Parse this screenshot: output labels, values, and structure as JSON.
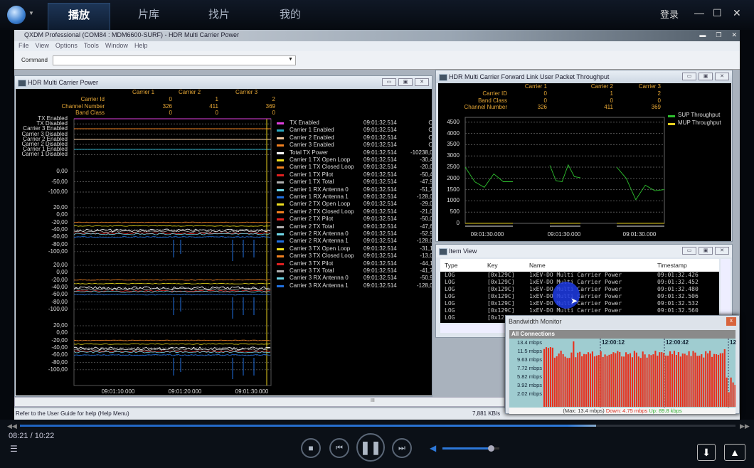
{
  "player": {
    "tabs": [
      "播放",
      "片库",
      "找片",
      "我的"
    ],
    "login": "登录",
    "time": "08:21 / 10:22",
    "progress": 0.805,
    "volume": 0.85,
    "icons": [
      "logo-icon",
      "minimize-icon",
      "maximize-icon",
      "close-icon",
      "stop-icon",
      "previous-icon",
      "pause-icon",
      "next-icon",
      "volume-icon",
      "playlist-icon",
      "download-icon",
      "share-icon"
    ]
  },
  "app": {
    "title": "QXDM Professional (COM84 : MDM6600-SURF) - HDR Multi Carrier Power",
    "menu": [
      "File",
      "View",
      "Options",
      "Tools",
      "Window",
      "Help"
    ],
    "command_label": "Command",
    "command_value": "",
    "status": "Refer to the User Guide for help (Help Menu)",
    "rate": "7,881 KB/s"
  },
  "power": {
    "title": "HDR Multi Carrier Power",
    "carriers": [
      "Carrier 1",
      "Carrier 2",
      "Carrier 3"
    ],
    "rows": [
      {
        "label": "Carrier Id",
        "vals": [
          "0",
          "1",
          "2"
        ]
      },
      {
        "label": "Channel Number",
        "vals": [
          "326",
          "411",
          "369"
        ]
      },
      {
        "label": "Band Class",
        "vals": [
          "0",
          "0",
          "0"
        ]
      }
    ],
    "state_labels": [
      "TX Enabled",
      "TX Disabled",
      "Carrier 3 Enabled",
      "Carrier 3 Disabled",
      "Carrier 2 Enabled",
      "Carrier 2 Disabled",
      "Carrier 1 Enabled",
      "Carrier 1 Disabled"
    ],
    "panel1_ticks": [
      "0,00",
      "-50,00",
      "-100,00"
    ],
    "panel_ticks": [
      "20,00",
      "0,00",
      "-20,00",
      "-40,00",
      "-60,00",
      "-80,00",
      "-100,00"
    ],
    "x_ticks": [
      "09:01:10.000",
      "09:01:20.000",
      "09:01:30.000"
    ],
    "legend": [
      {
        "name": "TX Enabled",
        "time": "09:01:32.514",
        "value": "On",
        "color": "#e040e0"
      },
      {
        "name": "Carrier 1 Enabled",
        "time": "09:01:32.514",
        "value": "On",
        "color": "#2aa8c0"
      },
      {
        "name": "Carrier 2 Enabled",
        "time": "09:01:32.514",
        "value": "On",
        "color": "#f0c8a0"
      },
      {
        "name": "Carrier 3 Enabled",
        "time": "09:01:32.514",
        "value": "On",
        "color": "#f08020"
      },
      {
        "name": "Total TX Power",
        "time": "09:01:32.514",
        "value": "-10238,00",
        "color": "#ffffff"
      },
      {
        "name": "Carrier 1 TX Open Loop",
        "time": "09:01:32.514",
        "value": "-30,41",
        "color": "#f0e020"
      },
      {
        "name": "Carrier 1 TX Closed Loop",
        "time": "09:01:32.514",
        "value": "-20,00",
        "color": "#f08020"
      },
      {
        "name": "Carrier 1 TX Pilot",
        "time": "09:01:32.514",
        "value": "-50,41",
        "color": "#e02020"
      },
      {
        "name": "Carrier 1 TX Total",
        "time": "09:01:32.514",
        "value": "-47,97",
        "color": "#b0b0b0"
      },
      {
        "name": "Carrier 1 RX Antenna 0",
        "time": "09:01:32.514",
        "value": "-51,78",
        "color": "#70d8e8"
      },
      {
        "name": "Carrier 1 RX Antenna 1",
        "time": "09:01:32.514",
        "value": "-128,00",
        "color": "#2070e0"
      },
      {
        "name": "Carrier 2 TX Open Loop",
        "time": "09:01:32.514",
        "value": "-29,06",
        "color": "#f0e020"
      },
      {
        "name": "Carrier 2 TX Closed Loop",
        "time": "09:01:32.514",
        "value": "-21,00",
        "color": "#f08020"
      },
      {
        "name": "Carrier 2 TX Pilot",
        "time": "09:01:32.514",
        "value": "-50,06",
        "color": "#e02020"
      },
      {
        "name": "Carrier 2 TX Total",
        "time": "09:01:32.514",
        "value": "-47,62",
        "color": "#b0b0b0"
      },
      {
        "name": "Carrier 2 RX Antenna 0",
        "time": "09:01:32.514",
        "value": "-52,94",
        "color": "#70d8e8"
      },
      {
        "name": "Carrier 2 RX Antenna 1",
        "time": "09:01:32.514",
        "value": "-128,00",
        "color": "#2070e0"
      },
      {
        "name": "Carrier 3 TX Open Loop",
        "time": "09:01:32.514",
        "value": "-31,18",
        "color": "#f0e020"
      },
      {
        "name": "Carrier 3 TX Closed Loop",
        "time": "09:01:32.514",
        "value": "-13,00",
        "color": "#f08020"
      },
      {
        "name": "Carrier 3 TX Pilot",
        "time": "09:01:32.514",
        "value": "-44,18",
        "color": "#e02020"
      },
      {
        "name": "Carrier 3 TX Total",
        "time": "09:01:32.514",
        "value": "-41,73",
        "color": "#b0b0b0"
      },
      {
        "name": "Carrier 3 RX Antenna 0",
        "time": "09:01:32.514",
        "value": "-50,91",
        "color": "#70d8e8"
      },
      {
        "name": "Carrier 3 RX Antenna 1",
        "time": "09:01:32.514",
        "value": "-128,00",
        "color": "#2070e0"
      }
    ]
  },
  "throughput": {
    "title": "HDR Multi Carrier Forward Link User Packet Throughput",
    "carriers": [
      "Carrier 1",
      "Carrier 2",
      "Carrier 3"
    ],
    "rows": [
      {
        "label": "Carrier ID",
        "vals": [
          "0",
          "1",
          "2"
        ]
      },
      {
        "label": "Band Class",
        "vals": [
          "0",
          "0",
          "0"
        ]
      },
      {
        "label": "Channel Number",
        "vals": [
          "326",
          "411",
          "369"
        ]
      }
    ],
    "legend": [
      {
        "name": "SUP Throughput",
        "color": "#2ec02e"
      },
      {
        "name": "MUP Throughput",
        "color": "#e8d020"
      }
    ],
    "y_ticks": [
      "4500",
      "4000",
      "3500",
      "3000",
      "2500",
      "2000",
      "1500",
      "1000",
      "500",
      "0"
    ],
    "x_ticks": [
      "09:01:30.000",
      "09:01:30.000",
      "09:01:30.000"
    ],
    "sup_segments": [
      [
        2500,
        1850,
        1600,
        2200,
        1850,
        1850
      ],
      [
        2580,
        1900,
        1850,
        2600,
        2080,
        2030
      ],
      [
        2500,
        2000,
        1050,
        1700,
        1450,
        1500
      ]
    ]
  },
  "items": {
    "title": "Item View",
    "columns": [
      "Type",
      "Key",
      "Name",
      "Timestamp"
    ],
    "rows": [
      [
        "LOG",
        "[0x129C]",
        "1xEV-DO Multi Carrier Power",
        "09:01:32.426"
      ],
      [
        "LOG",
        "[0x129C]",
        "1xEV-DO Multi Carrier Power",
        "09:01:32.452"
      ],
      [
        "LOG",
        "[0x129C]",
        "1xEV-DO Multi Carrier Power",
        "09:01:32.480"
      ],
      [
        "LOG",
        "[0x129C]",
        "1xEV-DO Multi Carrier Power",
        "09:01:32.506"
      ],
      [
        "LOG",
        "[0x129C]",
        "1xEV-DO Multi Carrier Power",
        "09:01:32.532"
      ],
      [
        "LOG",
        "[0x129C]",
        "1xEV-DO Multi Carrier Power",
        "09:01:32.560"
      ],
      [
        "LOG",
        "[0x12",
        "",
        ""
      ]
    ]
  },
  "bandwidth": {
    "title": "Bandwidth Monitor",
    "section": "All Connections",
    "y_ticks": [
      "13.4 mbps",
      "11.5 mbps",
      "9.63 mbps",
      "7.72 mbps",
      "5.82 mbps",
      "3.92 mbps",
      "2.02 mbps"
    ],
    "x_ticks": [
      "12:00:12",
      "12:00:42",
      "12"
    ],
    "max": "(Max: 13.4 mbps)",
    "down": "Down: 4.75 mbps",
    "up": "Up: 89.8 kbps",
    "down_color": "#e03020",
    "up_color": "#30b030"
  }
}
